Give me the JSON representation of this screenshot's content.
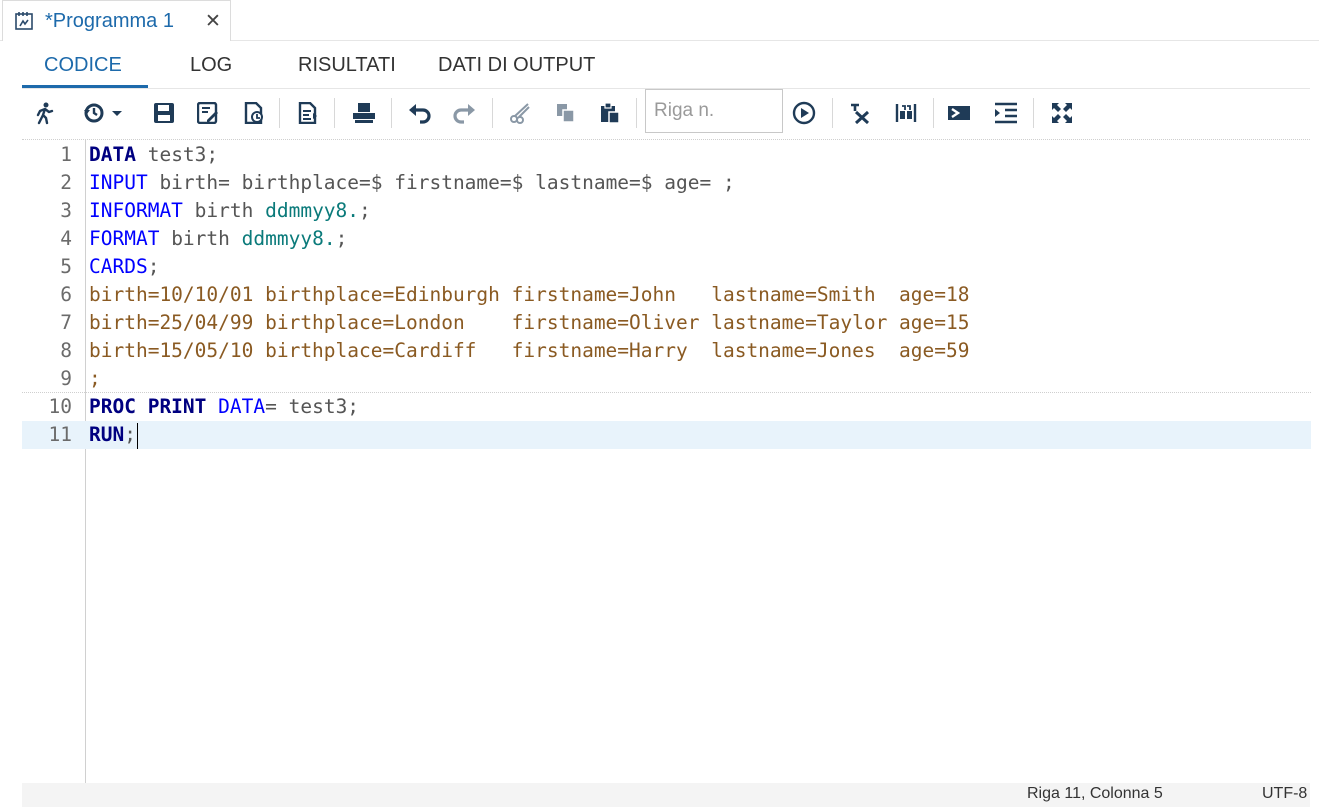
{
  "document_tab": {
    "title": "*Programma 1",
    "icon": "program-icon",
    "close_icon": "close-icon",
    "close_glyph": "✕"
  },
  "subtabs": [
    {
      "label": "CODICE",
      "active": true
    },
    {
      "label": "LOG",
      "active": false
    },
    {
      "label": "RISULTATI",
      "active": false
    },
    {
      "label": "DATI DI OUTPUT",
      "active": false
    }
  ],
  "toolbar": {
    "icons": [
      "run-icon",
      "history-icon",
      "save-icon",
      "save-as-icon",
      "export-icon",
      "format-code-icon",
      "print-icon",
      "undo-icon",
      "redo-icon",
      "cut-icon",
      "copy-icon",
      "paste-icon",
      "go-to-line-icon",
      "clear-icon",
      "snippets-icon",
      "submit-selection-icon",
      "toggle-lines-icon",
      "maximize-icon"
    ],
    "goto_placeholder": "Riga n.",
    "accent_color": "#1d6aab"
  },
  "editor": {
    "line_numbers": [
      "1",
      "2",
      "3",
      "4",
      "5",
      "6",
      "7",
      "8",
      "9",
      "10",
      "11"
    ],
    "lines": [
      [
        {
          "t": "DATA",
          "c": "kw"
        },
        {
          "t": " test3;",
          "c": "plain"
        }
      ],
      [
        {
          "t": "INPUT",
          "c": "stmt"
        },
        {
          "t": " birth= birthplace=$ firstname=$ lastname=$ age= ;",
          "c": "plain"
        }
      ],
      [
        {
          "t": "INFORMAT",
          "c": "stmt"
        },
        {
          "t": " birth ",
          "c": "plain"
        },
        {
          "t": "ddmmyy8.",
          "c": "fmt"
        },
        {
          "t": ";",
          "c": "plain"
        }
      ],
      [
        {
          "t": "FORMAT",
          "c": "stmt"
        },
        {
          "t": " birth ",
          "c": "plain"
        },
        {
          "t": "ddmmyy8.",
          "c": "fmt"
        },
        {
          "t": ";",
          "c": "plain"
        }
      ],
      [
        {
          "t": "CARDS",
          "c": "stmt"
        },
        {
          "t": ";",
          "c": "plain"
        }
      ],
      [
        {
          "t": "birth=10/10/01 birthplace=Edinburgh firstname=John   lastname=Smith  age=18",
          "c": "data"
        }
      ],
      [
        {
          "t": "birth=25/04/99 birthplace=London    firstname=Oliver lastname=Taylor age=15",
          "c": "data"
        }
      ],
      [
        {
          "t": "birth=15/05/10 birthplace=Cardiff   firstname=Harry  lastname=Jones  age=59",
          "c": "data"
        }
      ],
      [
        {
          "t": ";",
          "c": "data"
        }
      ],
      [
        {
          "t": "PROC PRINT",
          "c": "kw"
        },
        {
          "t": " ",
          "c": "plain"
        },
        {
          "t": "DATA",
          "c": "stmt"
        },
        {
          "t": "= test3;",
          "c": "plain"
        }
      ],
      [
        {
          "t": "RUN",
          "c": "kw"
        },
        {
          "t": ";",
          "c": "plain"
        }
      ]
    ],
    "current_line": 11
  },
  "status": {
    "position": "Riga 11, Colonna 5",
    "encoding": "UTF-8"
  }
}
